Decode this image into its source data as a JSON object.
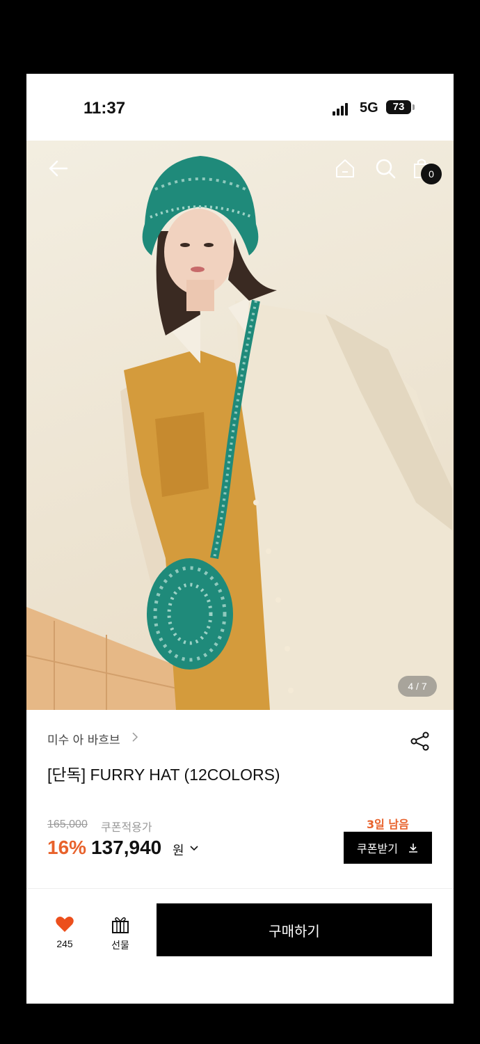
{
  "status_bar": {
    "time": "11:37",
    "network": "5G",
    "battery": "73"
  },
  "header": {
    "back_icon": "arrow-left-icon",
    "home_icon": "home-icon",
    "search_icon": "search-icon",
    "cart_icon": "shopping-bag-icon",
    "cart_count": "0"
  },
  "gallery": {
    "page_indicator": "4 / 7"
  },
  "product": {
    "brand": "미수 아 바흐브",
    "title": "[단독] FURRY HAT (12COLORS)",
    "original_price": "165,000",
    "coupon_price_label": "쿠폰적용가",
    "discount": "16%",
    "price": "137,940",
    "currency": "원",
    "days_left": "3일 남음",
    "coupon_button": "쿠폰받기"
  },
  "bottom_bar": {
    "like_count": "245",
    "gift_label": "선물",
    "buy_button": "구매하기"
  },
  "colors": {
    "accent": "#e8622c",
    "primary": "#000000",
    "heart": "#ec4f1c"
  }
}
